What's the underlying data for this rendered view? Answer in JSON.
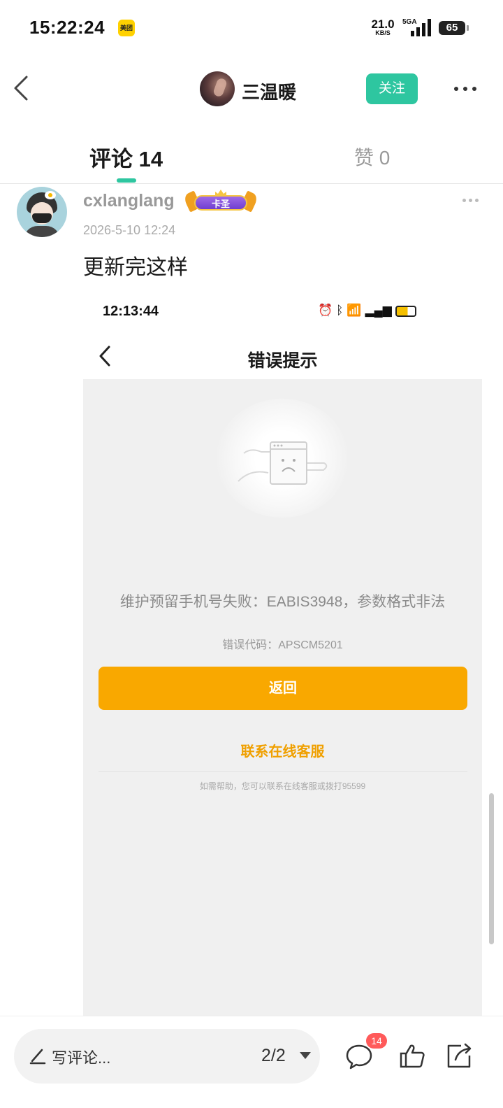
{
  "status_bar": {
    "time": "15:22:24",
    "app_badge": "美团",
    "net_speed": "21.0",
    "net_unit": "KB/S",
    "network": "5GA",
    "battery": "65"
  },
  "header": {
    "title": "三温暖",
    "follow_label": "关注"
  },
  "tabs": {
    "comments_label": "评论 14",
    "likes_label": "赞 0"
  },
  "comment": {
    "username": "cxlanglang",
    "badge": "卡圣",
    "timestamp": "2026-5-10 12:24",
    "text": "更新完这样"
  },
  "embedded": {
    "time": "12:13:44",
    "title": "错误提示",
    "message": "维护预留手机号失败：EABIS3948，参数格式非法",
    "error_code": "错误代码：APSCM5201",
    "return_label": "返回",
    "service_label": "联系在线客服",
    "help_text": "如需帮助，您可以联系在线客服或拨打95599",
    "accent_color": "#f9a800"
  },
  "bottom_bar": {
    "placeholder": "写评论...",
    "page": "2/2",
    "comment_count": "14"
  },
  "colors": {
    "brand": "#2ec6a0",
    "badge_red": "#ff5a5a"
  }
}
